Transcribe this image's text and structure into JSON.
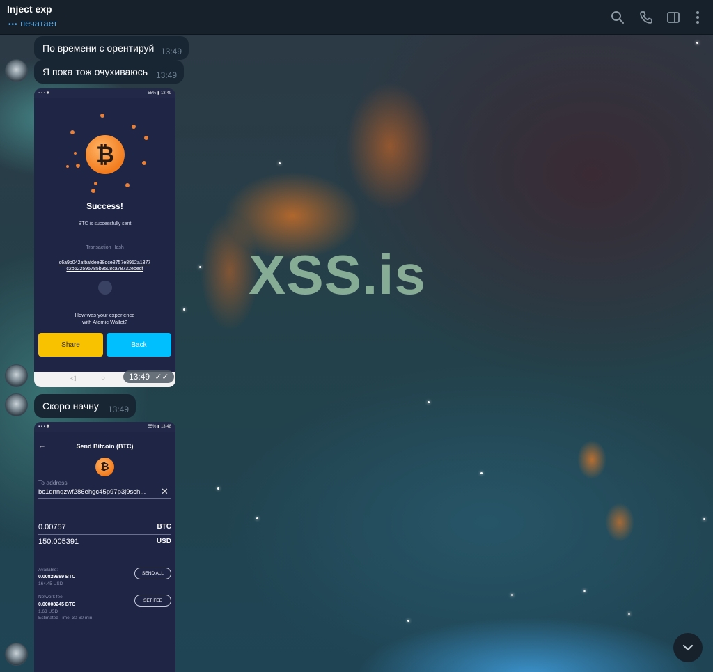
{
  "header": {
    "title": "Inject exp",
    "status": "печатает",
    "typing_dots": "•••"
  },
  "watermark": "XSS.is",
  "messages": [
    {
      "text": "По времени с орентируй",
      "time": "13:49"
    },
    {
      "text": "Я пока тож очухиваюсь",
      "time": "13:49"
    },
    {
      "text": "Скоро начну",
      "time": "13:49"
    }
  ],
  "shot1": {
    "status_left": "▪ ▪ ▪ ✱",
    "status_right": "55% ▮ 13:49",
    "coin_symbol": "₿",
    "title": "Success!",
    "subtitle": "BTC is successfully sent",
    "hash_label": "Transaction Hash",
    "hash_line1": "c6a9b042afbafdee38dce8757e8952a1377",
    "hash_line2": "c2b622595785b9508ca78732ebedf",
    "question_line1": "How was your experience",
    "question_line2": "with Atomic Wallet?",
    "share_label": "Share",
    "back_label": "Back",
    "time": "13:49"
  },
  "shot2": {
    "status_left": "▪ ▪ ▪ ✱",
    "status_right": "55% ▮ 13:48",
    "title": "Send Bitcoin (BTC)",
    "coin_symbol": "₿",
    "to_label": "To address",
    "address": "bc1qnnqzwf286ehgc45p97p3j9sch...",
    "amount_btc": "0.00757",
    "unit_btc": "BTC",
    "amount_usd": "150.005391",
    "unit_usd": "USD",
    "available_label": "Available:",
    "available_btc": "0.00829989 BTC",
    "available_usd": "164.45 USD",
    "send_all_label": "SEND ALL",
    "fee_label": "Network fee:",
    "fee_btc": "0.00008245 BTC",
    "fee_usd": "1.63 USD",
    "fee_time": "Estimated Time: 30-60 min",
    "set_fee_label": "SET FEE"
  },
  "icons": {
    "search": "search-icon",
    "call": "phone-icon",
    "sidebar": "sidebar-toggle-icon",
    "more": "more-vertical-icon",
    "scroll": "chevron-down-icon"
  },
  "colors": {
    "header_bg": "#17212b",
    "bubble_bg": "#182533",
    "accent": "#5ea8e0",
    "share_btn": "#f9c200",
    "back_btn": "#00bfff",
    "bitcoin": "#f27c1e"
  }
}
